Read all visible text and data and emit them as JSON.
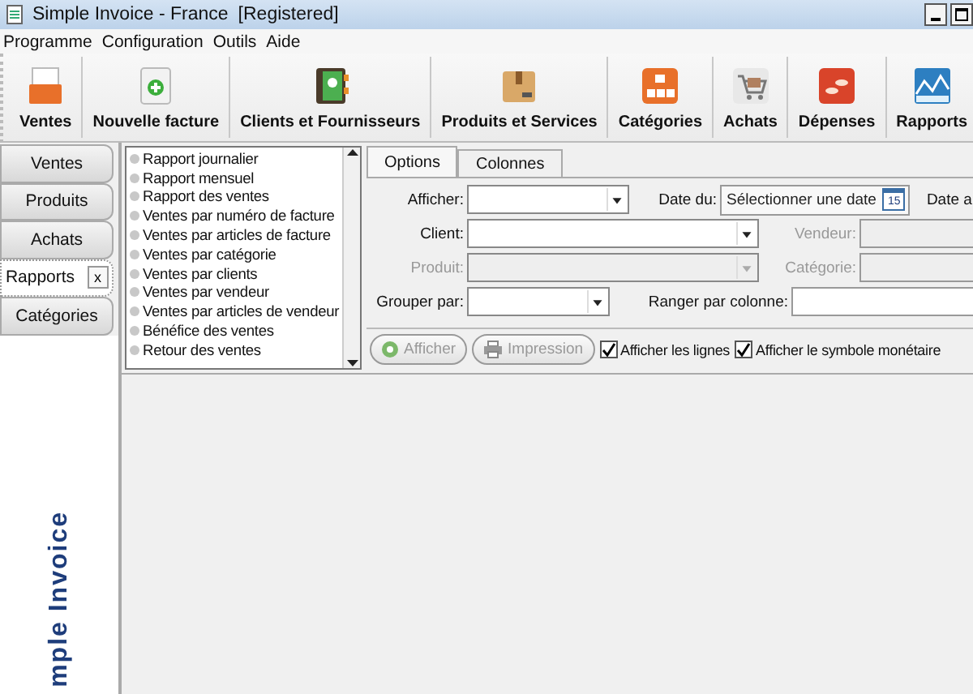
{
  "window": {
    "title": "Simple Invoice - France",
    "status": "[Registered]"
  },
  "menu": [
    "Programme",
    "Configuration",
    "Outils",
    "Aide"
  ],
  "toolbar": [
    "Ventes",
    "Nouvelle facture",
    "Clients et Fournisseurs",
    "Produits et Services",
    "Catégories",
    "Achats",
    "Dépenses",
    "Rapports"
  ],
  "side_tabs": [
    {
      "label": "Ventes",
      "selected": false
    },
    {
      "label": "Produits",
      "selected": false
    },
    {
      "label": "Achats",
      "selected": false
    },
    {
      "label": "Rapports",
      "selected": true,
      "close": "x"
    },
    {
      "label": "Catégories",
      "selected": false
    }
  ],
  "report_list": [
    "Rapport journalier",
    "Rapport mensuel",
    "Rapport des ventes",
    "Ventes par numéro de facture",
    "Ventes par articles de facture",
    "Ventes par catégorie",
    "Ventes par clients",
    "Ventes par vendeur",
    "Ventes par articles de vendeur",
    "Bénéfice des ventes",
    "Retour des ventes"
  ],
  "form_tabs": [
    {
      "label": "Options",
      "selected": true
    },
    {
      "label": "Colonnes",
      "selected": false
    }
  ],
  "form_rows": [
    {
      "label": "Afficher:",
      "disabled": false,
      "kind": "combo",
      "label2": "Date du:",
      "label2_disabled": false,
      "second": {
        "kind": "date",
        "placeholder": "Sélectionner une date",
        "icon_text": "15"
      },
      "label3": "Date a"
    },
    {
      "label": "Client:",
      "disabled": false,
      "kind": "combo",
      "label2": "Vendeur:",
      "label2_disabled": true,
      "second": {
        "kind": "text"
      }
    },
    {
      "label": "Produit:",
      "disabled": true,
      "kind": "combo",
      "label2": "Catégorie:",
      "label2_disabled": true,
      "second": {
        "kind": "text"
      }
    },
    {
      "label": "Grouper par:",
      "disabled": false,
      "kind": "combo",
      "label2": "Ranger par colonne:",
      "label2_disabled": false,
      "second": {
        "kind": "text"
      }
    }
  ],
  "actions": [
    {
      "label": "Afficher",
      "disabled": true
    },
    {
      "label": "Impression",
      "disabled": true
    }
  ],
  "checkboxes": [
    {
      "label": "Afficher les lignes",
      "checked": true
    },
    {
      "label": "Afficher le symbole monétaire",
      "checked": true
    }
  ],
  "logo_text": "mple Invoice"
}
